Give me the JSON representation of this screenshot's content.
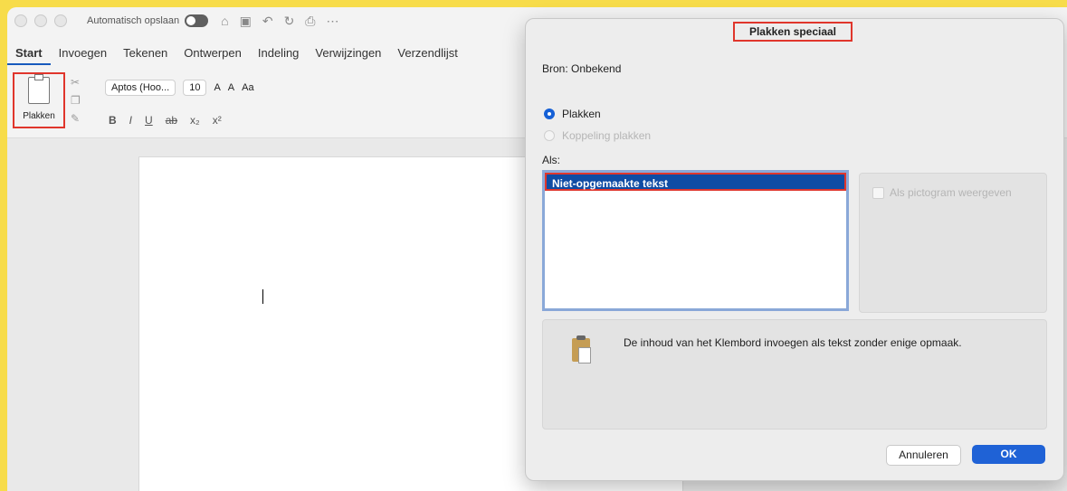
{
  "window": {
    "autosave_label": "Automatisch opslaan",
    "tabs": [
      "Start",
      "Invoegen",
      "Tekenen",
      "Ontwerpen",
      "Indeling",
      "Verwijzingen",
      "Verzendlijst"
    ],
    "paste_label": "Plakken",
    "font_name": "Aptos (Hoo...",
    "font_size": "10",
    "font_case": "Aa"
  },
  "dialog": {
    "title": "Plakken speciaal",
    "source_label": "Bron:",
    "source_value": "Onbekend",
    "option_paste": "Plakken",
    "option_paste_link": "Koppeling plakken",
    "as_label": "Als:",
    "list_items": [
      "Niet-opgemaakte tekst"
    ],
    "show_as_icon": "Als pictogram weergeven",
    "description": "De inhoud van het Klembord invoegen als tekst zonder enige opmaak.",
    "cancel_label": "Annuleren",
    "ok_label": "OK"
  }
}
